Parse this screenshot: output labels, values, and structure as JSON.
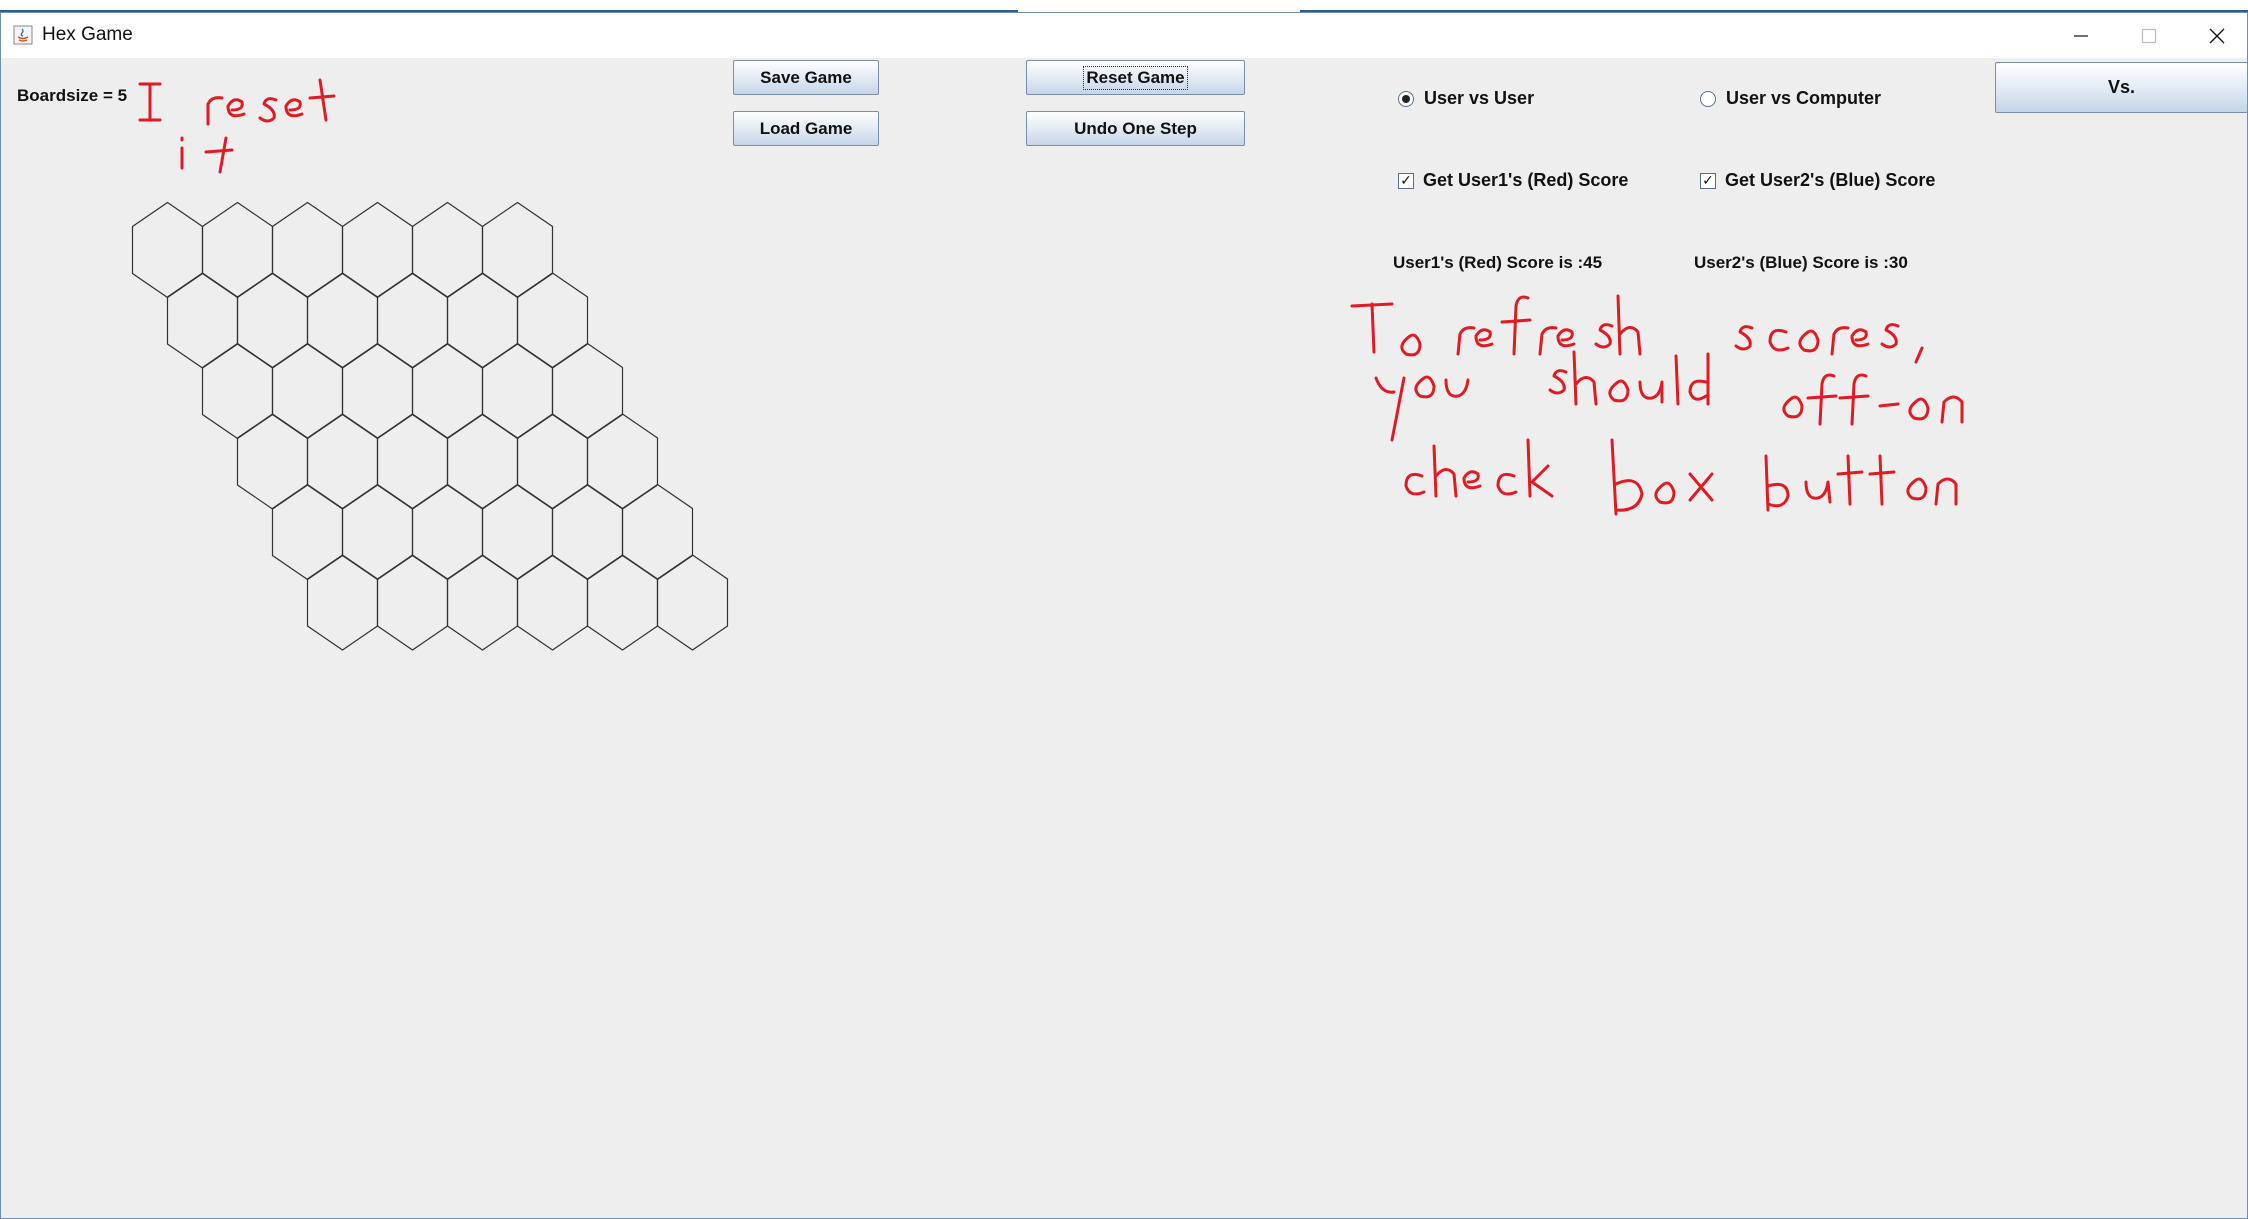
{
  "window": {
    "title": "Hex Game"
  },
  "board": {
    "label": "Boardsize = 5",
    "rows": 6,
    "cols": 6
  },
  "buttons": {
    "save": "Save Game",
    "load": "Load Game",
    "reset": "Reset Game",
    "undo": "Undo One Step",
    "vs": "Vs."
  },
  "mode": {
    "user_vs_user": "User vs User",
    "user_vs_computer": "User vs Computer",
    "selected": "user_vs_user"
  },
  "scores": {
    "get_red_label": "Get User1's (Red) Score",
    "get_blue_label": "Get User2's (Blue) Score",
    "red_checked": true,
    "blue_checked": true,
    "red_text": "User1's (Red) Score is :45",
    "blue_text": "User2's (Blue) Score is :30"
  },
  "annotation": {
    "color": "#e01b24",
    "text": "I reset if To refresh scores, you should off-on checkbox button"
  },
  "colors": {
    "hex_stroke": "#333333",
    "button_border": "#7a8ea8"
  }
}
